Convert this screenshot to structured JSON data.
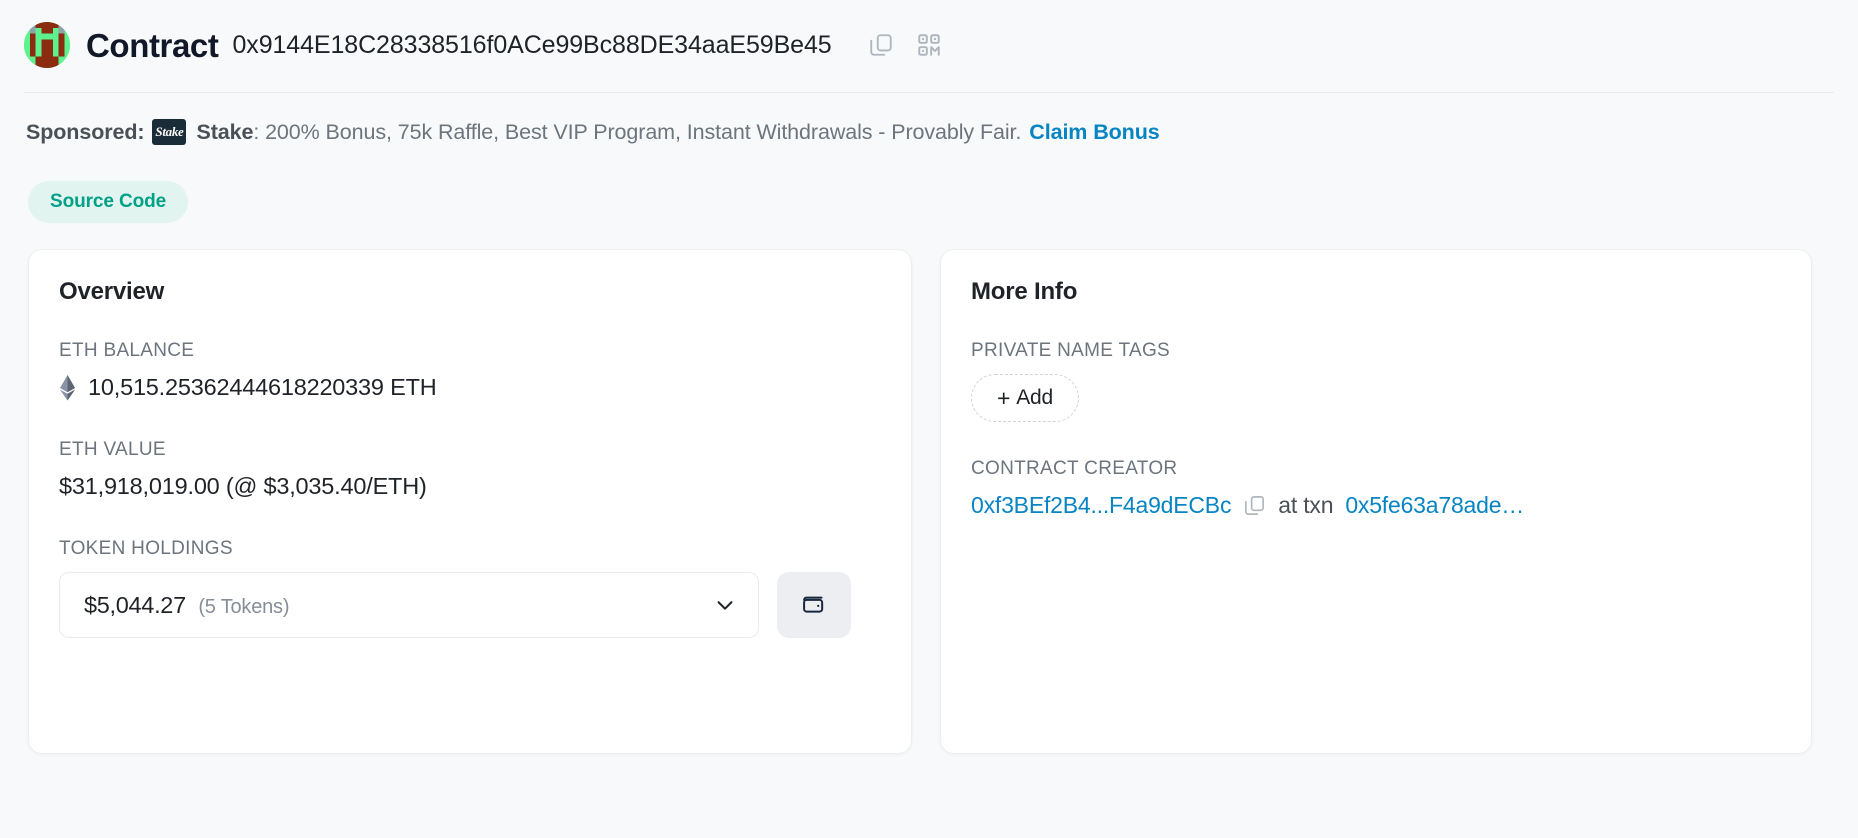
{
  "header": {
    "title": "Contract",
    "address": "0x9144E18C28338516f0ACe99Bc88DE34aaE59Be45",
    "copy_icon": "copy-icon",
    "qr_icon": "qr-code-icon"
  },
  "sponsored": {
    "label": "Sponsored:",
    "advertiser_logo_text": "Stake",
    "advertiser": "Stake",
    "message": ": 200% Bonus, 75k Raffle, Best VIP Program, Instant Withdrawals - Provably Fair.",
    "cta": "Claim Bonus",
    "cta_color": "#0784c3"
  },
  "tabs": [
    {
      "label": "Source Code",
      "active": true,
      "bg": "#e2f4f0",
      "fg": "#00a186"
    }
  ],
  "overview": {
    "title": "Overview",
    "eth_balance_label": "ETH BALANCE",
    "eth_balance_value": "10,515.25362444618220339 ETH",
    "eth_value_label": "ETH VALUE",
    "eth_value_value": "$31,918,019.00 (@ $3,035.40/ETH)",
    "token_holdings_label": "TOKEN HOLDINGS",
    "token_holdings_amount": "$5,044.27",
    "token_holdings_count": "(5 Tokens)",
    "dropdown_icon": "chevron-down-icon",
    "wallet_icon": "wallet-icon"
  },
  "more_info": {
    "title": "More Info",
    "private_name_tags_label": "PRIVATE NAME TAGS",
    "add_button_plus": "+",
    "add_button_label": "Add",
    "contract_creator_label": "CONTRACT CREATOR",
    "creator_address": "0xf3BEf2B4...F4a9dECBc",
    "creator_copy_icon": "copy-icon",
    "at_txn_text": "at txn",
    "creation_txn": "0x5fe63a78ade…"
  },
  "colors": {
    "page_bg": "#f8f9fa",
    "card_bg": "#ffffff",
    "link": "#0784c3",
    "accent_teal": "#00a186",
    "muted": "#6c757d"
  }
}
